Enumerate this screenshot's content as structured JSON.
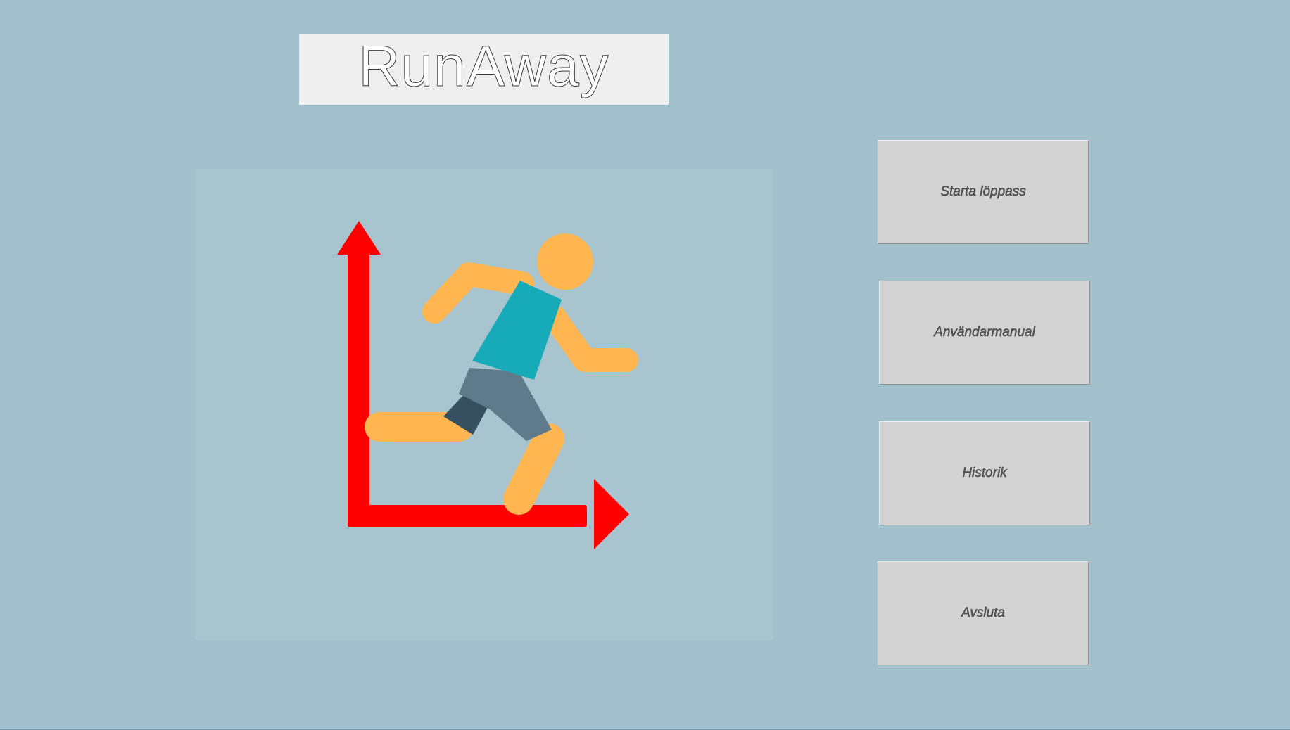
{
  "app": {
    "title": "RunAway"
  },
  "logo": {
    "icon": "runner-with-axes-icon",
    "colors": {
      "axes": "#ff0000",
      "skin": "#ffb651",
      "shirt": "#17aab8",
      "shorts": "#5f7b8b",
      "shorts_dark": "#36505f"
    }
  },
  "menu": {
    "buttons": [
      {
        "label": "Starta löppass"
      },
      {
        "label": "Användarmanual"
      },
      {
        "label": "Historik"
      },
      {
        "label": "Avsluta"
      }
    ]
  },
  "colors": {
    "background": "#a2bfcc",
    "button_face": "#d3d3d3",
    "title_box": "#efefef"
  }
}
